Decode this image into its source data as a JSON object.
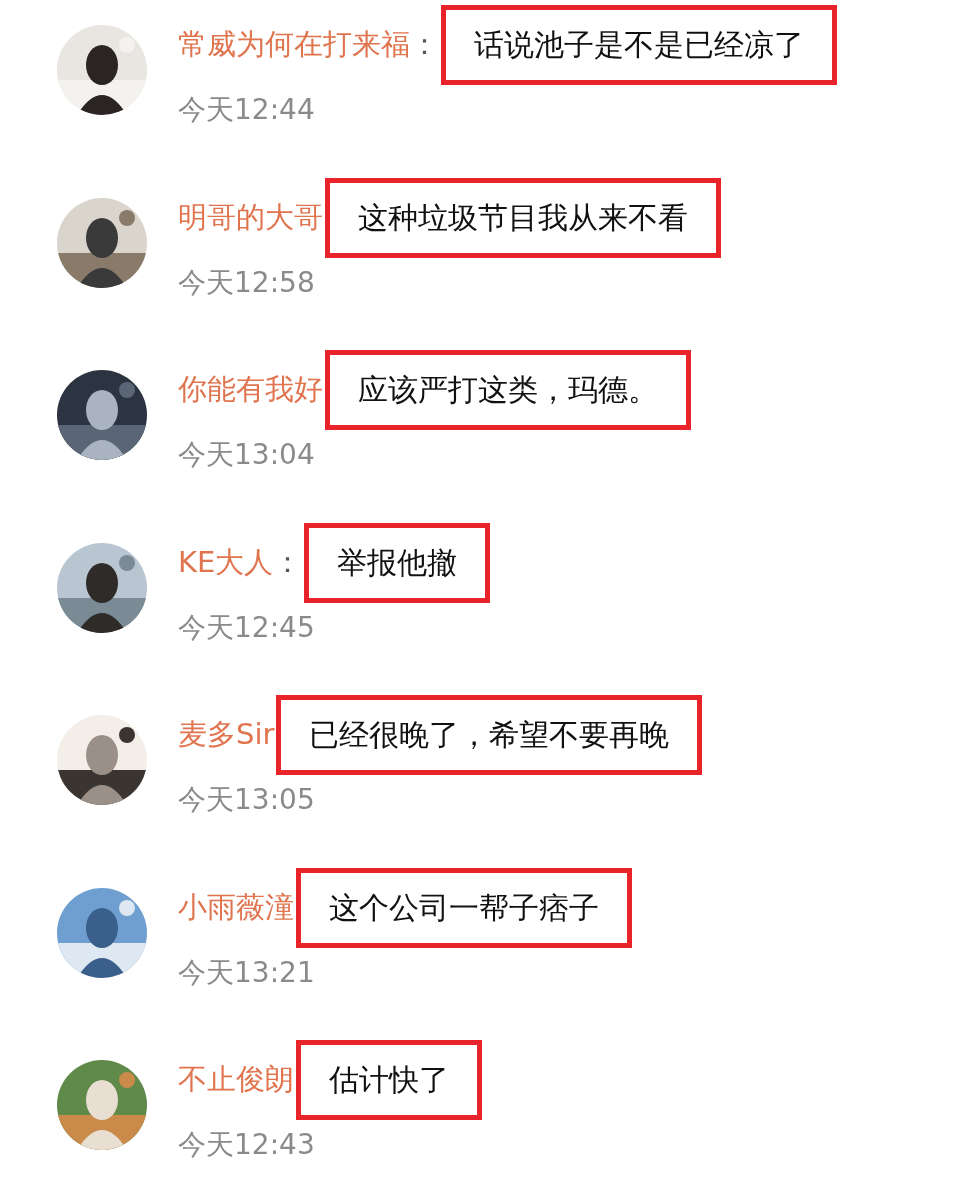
{
  "comments": [
    {
      "name": "常威为何在打来福",
      "separator": "：",
      "text": "话说池子是不是已经凉了",
      "time": "今天12:44",
      "highlighted": true
    },
    {
      "name": "明哥的大哥",
      "text": "这种垃圾节目我从来不看",
      "time": "今天12:58",
      "highlighted": true
    },
    {
      "name": "你能有我好",
      "text": "应该严打这类，玛德。",
      "time": "今天13:04",
      "highlighted": true
    },
    {
      "name": "KE大人",
      "separator": "：",
      "text": "举报他撤",
      "time": "今天12:45",
      "highlighted": true
    },
    {
      "name": "麦多Sir",
      "text": "已经很晚了，希望不要再晚",
      "time": "今天13:05",
      "highlighted": true
    },
    {
      "name": "小雨薇潼",
      "text": "这个公司一帮子痞子",
      "time": "今天13:21",
      "highlighted": true
    },
    {
      "name": "不止俊朗",
      "text": "估计快了",
      "time": "今天12:43",
      "highlighted": true
    }
  ]
}
